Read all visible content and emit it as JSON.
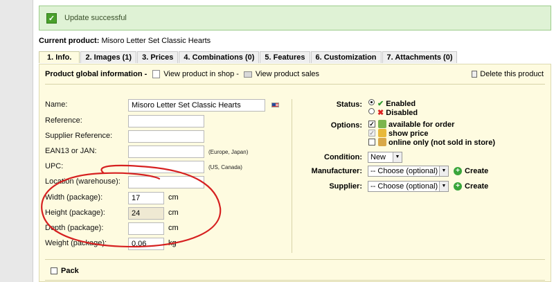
{
  "notification": {
    "icon": "check-icon",
    "text": "Update successful"
  },
  "current": {
    "label": "Current product:",
    "name": "Misoro Letter Set Classic Hearts"
  },
  "tabs": [
    {
      "label": "1. Info."
    },
    {
      "label": "2. Images (1)"
    },
    {
      "label": "3. Prices"
    },
    {
      "label": "4. Combinations (0)"
    },
    {
      "label": "5. Features"
    },
    {
      "label": "6. Customization"
    },
    {
      "label": "7. Attachments (0)"
    }
  ],
  "panel": {
    "title": "Product global information -",
    "view_shop": "View product in shop -",
    "view_sales": "View product sales",
    "delete": "Delete this product"
  },
  "fields": {
    "name": {
      "label": "Name:",
      "value": "Misoro Letter Set Classic Hearts"
    },
    "reference": {
      "label": "Reference:",
      "value": ""
    },
    "supplier_reference": {
      "label": "Supplier Reference:",
      "value": ""
    },
    "ean13": {
      "label": "EAN13 or JAN:",
      "value": "",
      "hint": "(Europe, Japan)"
    },
    "upc": {
      "label": "UPC:",
      "value": "",
      "hint": "(US, Canada)"
    },
    "location": {
      "label": "Location (warehouse):",
      "value": ""
    },
    "width": {
      "label": "Width (package):",
      "value": "17",
      "unit": "cm"
    },
    "height": {
      "label": "Height (package):",
      "value": "24",
      "unit": "cm"
    },
    "depth": {
      "label": "Depth (package):",
      "value": "",
      "unit": "cm"
    },
    "weight": {
      "label": "Weight (package):",
      "value": "0.06",
      "unit": "kg"
    }
  },
  "status": {
    "label": "Status:",
    "enabled": "Enabled",
    "disabled": "Disabled",
    "selected": "Enabled"
  },
  "options": {
    "label": "Options:",
    "available": "available for order",
    "show_price": "show price",
    "online_only": "online only (not sold in store)"
  },
  "condition": {
    "label": "Condition:",
    "value": "New"
  },
  "manufacturer": {
    "label": "Manufacturer:",
    "value": "-- Choose (optional) --",
    "create": "Create"
  },
  "supplier": {
    "label": "Supplier:",
    "value": "-- Choose (optional) --",
    "create": "Create"
  },
  "pack": {
    "label": "Pack"
  },
  "colors": {
    "annotation": "#d62020",
    "success_bg": "#dff2d5",
    "panel_bg": "#fefbe0"
  }
}
